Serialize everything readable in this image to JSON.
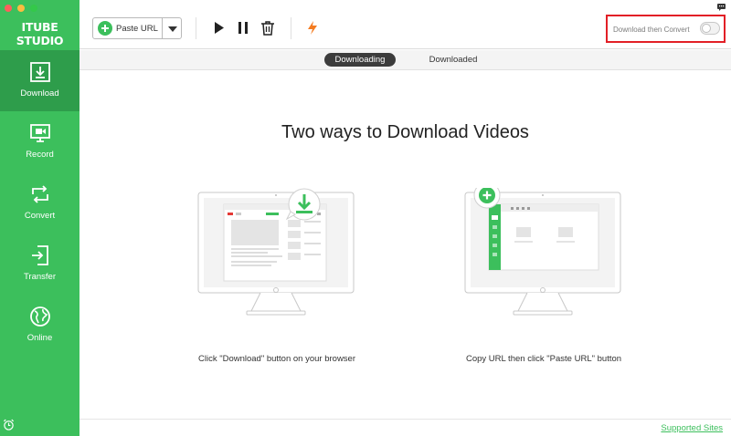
{
  "app": {
    "logo_text": "ITUBE STUDIO",
    "accent": "#3cbf5c",
    "accent_dark": "#2e9d4b"
  },
  "sidebar": {
    "items": [
      {
        "label": "Download",
        "icon": "download-icon",
        "active": true
      },
      {
        "label": "Record",
        "icon": "record-icon",
        "active": false
      },
      {
        "label": "Convert",
        "icon": "convert-icon",
        "active": false
      },
      {
        "label": "Transfer",
        "icon": "transfer-icon",
        "active": false
      },
      {
        "label": "Online",
        "icon": "globe-icon",
        "active": false
      }
    ]
  },
  "toolbar": {
    "paste_label": "Paste URL",
    "download_then_convert": "Download then Convert",
    "download_then_convert_on": false
  },
  "tabs": [
    {
      "label": "Downloading",
      "active": true
    },
    {
      "label": "Downloaded",
      "active": false
    }
  ],
  "main": {
    "headline": "Two ways to Download Videos",
    "caption_browser": "Click \"Download\" button on your browser",
    "caption_paste": "Copy URL then click \"Paste URL\" button"
  },
  "footer": {
    "supported_sites": "Supported Sites"
  }
}
